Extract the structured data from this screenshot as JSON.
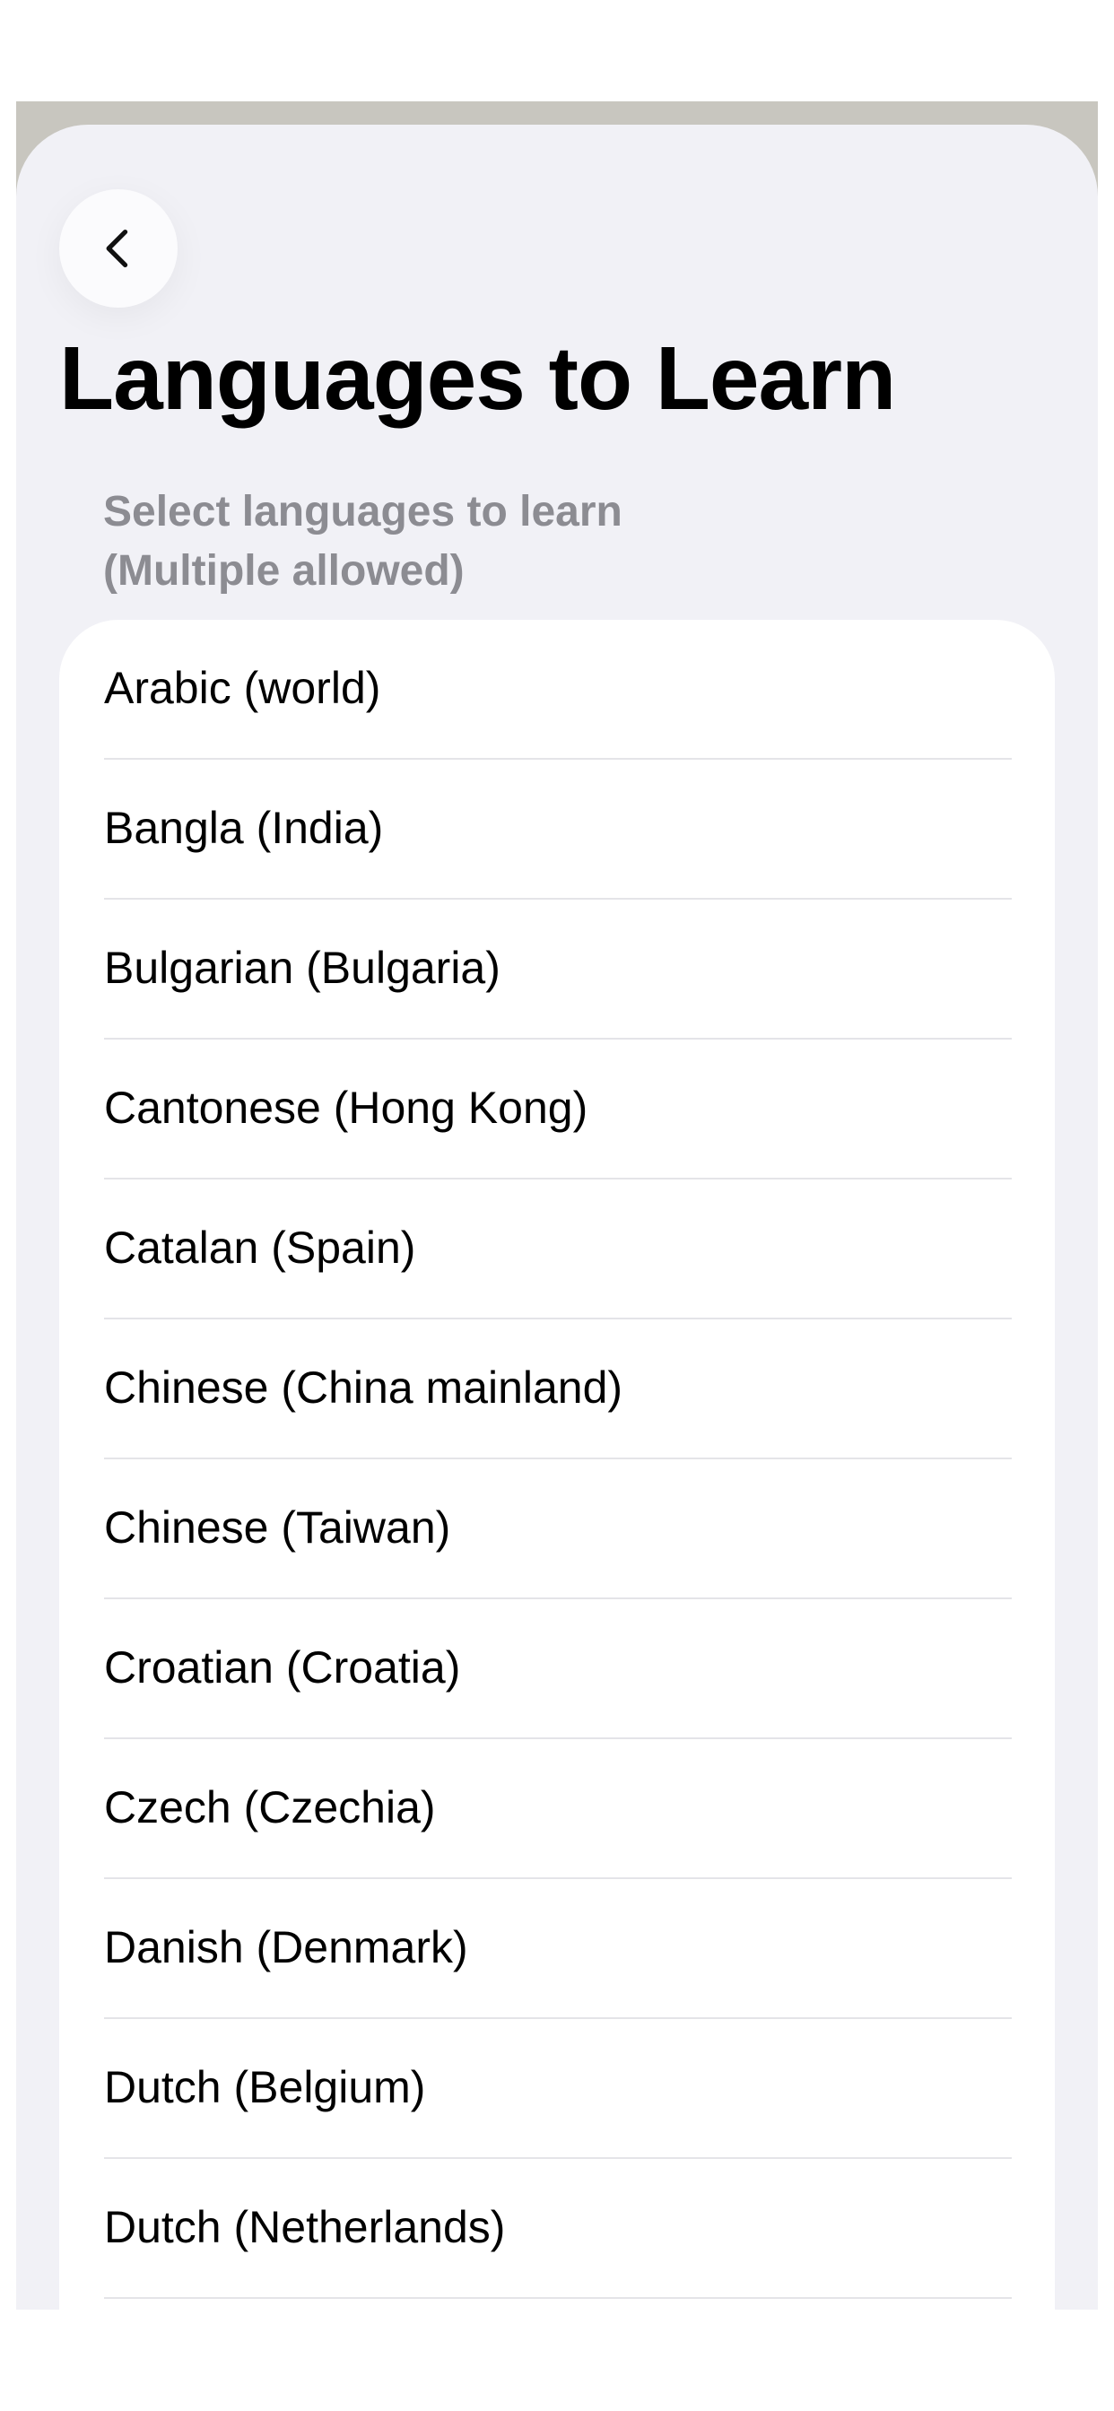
{
  "header": {
    "back_icon": "chevron-left-icon",
    "title": "Languages to Learn",
    "subtitle_line1": "Select languages to learn",
    "subtitle_line2": "(Multiple allowed)"
  },
  "languages": [
    "Arabic (world)",
    "Bangla (India)",
    "Bulgarian (Bulgaria)",
    "Cantonese (Hong Kong)",
    "Catalan (Spain)",
    "Chinese (China mainland)",
    "Chinese (Taiwan)",
    "Croatian (Croatia)",
    "Czech (Czechia)",
    "Danish (Denmark)",
    "Dutch (Belgium)",
    "Dutch (Netherlands)"
  ],
  "colors": {
    "background": "#f1f1f6",
    "card": "#ffffff",
    "title": "#000000",
    "subtitle": "#8c8c92",
    "separator": "#e4e4e8"
  }
}
